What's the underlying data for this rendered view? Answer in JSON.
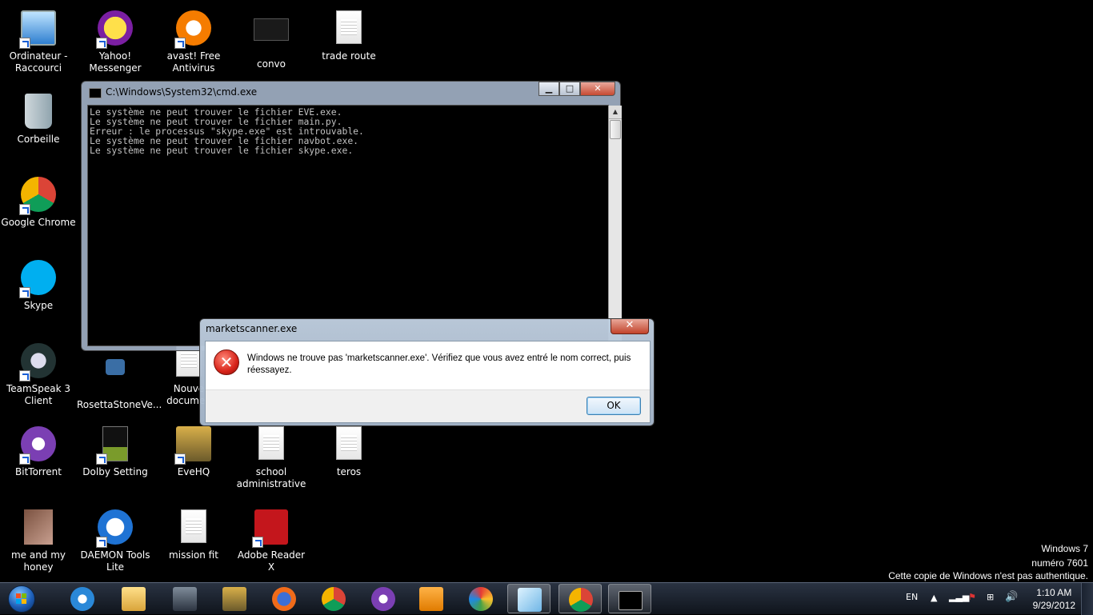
{
  "desktop_icons": [
    {
      "label": "Ordinateur -\nRaccourci",
      "icon": "computer-icon"
    },
    {
      "label": "Yahoo!\nMessenger",
      "icon": "yahoo-messenger-icon"
    },
    {
      "label": "avast! Free\nAntivirus",
      "icon": "avast-icon"
    },
    {
      "label": "convo",
      "icon": "screenshot-file-icon"
    },
    {
      "label": "trade route",
      "icon": "text-file-icon"
    },
    {
      "label": "Corbeille",
      "icon": "recycle-bin-icon"
    },
    {
      "label": "Google Chrome",
      "icon": "chrome-icon"
    },
    {
      "label": "Skype",
      "icon": "skype-icon"
    },
    {
      "label": "TeamSpeak 3\nClient",
      "icon": "teamspeak-icon"
    },
    {
      "label": "RosettaStoneVe...",
      "icon": "rosetta-stone-icon"
    },
    {
      "label": "Nouve\ndocumen",
      "icon": "text-file-icon"
    },
    {
      "label": "BitTorrent",
      "icon": "bittorrent-icon"
    },
    {
      "label": "Dolby Setting",
      "icon": "dolby-icon"
    },
    {
      "label": "EveHQ",
      "icon": "evehq-icon"
    },
    {
      "label": "school\nadministrative",
      "icon": "text-file-icon"
    },
    {
      "label": "teros",
      "icon": "text-file-icon"
    },
    {
      "label": "me and my\nhoney",
      "icon": "photo-icon"
    },
    {
      "label": "DAEMON Tools\nLite",
      "icon": "daemon-tools-icon"
    },
    {
      "label": "mission fit",
      "icon": "text-file-icon"
    },
    {
      "label": "Adobe Reader X",
      "icon": "adobe-reader-icon"
    }
  ],
  "cmd_window": {
    "title": "C:\\Windows\\System32\\cmd.exe",
    "output": "Le système ne peut trouver le fichier EVE.exe.\nLe système ne peut trouver le fichier main.py.\nErreur : le processus \"skype.exe\" est introuvable.\nLe système ne peut trouver le fichier navbot.exe.\nLe système ne peut trouver le fichier skype.exe."
  },
  "error_dialog": {
    "title": "marketscanner.exe",
    "message": "Windows ne trouve pas 'marketscanner.exe'. Vérifiez que vous avez entré le nom correct, puis réessayez.",
    "ok_label": "OK",
    "close_glyph": "✕"
  },
  "watermark": {
    "line1": "Windows 7",
    "line2": "numéro 7601",
    "line3": "Cette copie de Windows n'est pas authentique."
  },
  "taskbar": {
    "pinned": [
      "internet-explorer-icon",
      "windows-explorer-icon",
      "eve-online-icon",
      "evehq-icon",
      "firefox-icon",
      "chrome-icon",
      "bittorrent-icon",
      "media-player-icon",
      "patcher-icon",
      "window-switcher-icon",
      "chrome-icon",
      "cmd-icon"
    ],
    "active_index": 11,
    "language": "EN",
    "time": "1:10 AM",
    "date": "9/29/2012"
  },
  "colors": {
    "desktop": "#000000",
    "cmd_text": "#c0c0c0",
    "accent": "#1e5fb8"
  }
}
